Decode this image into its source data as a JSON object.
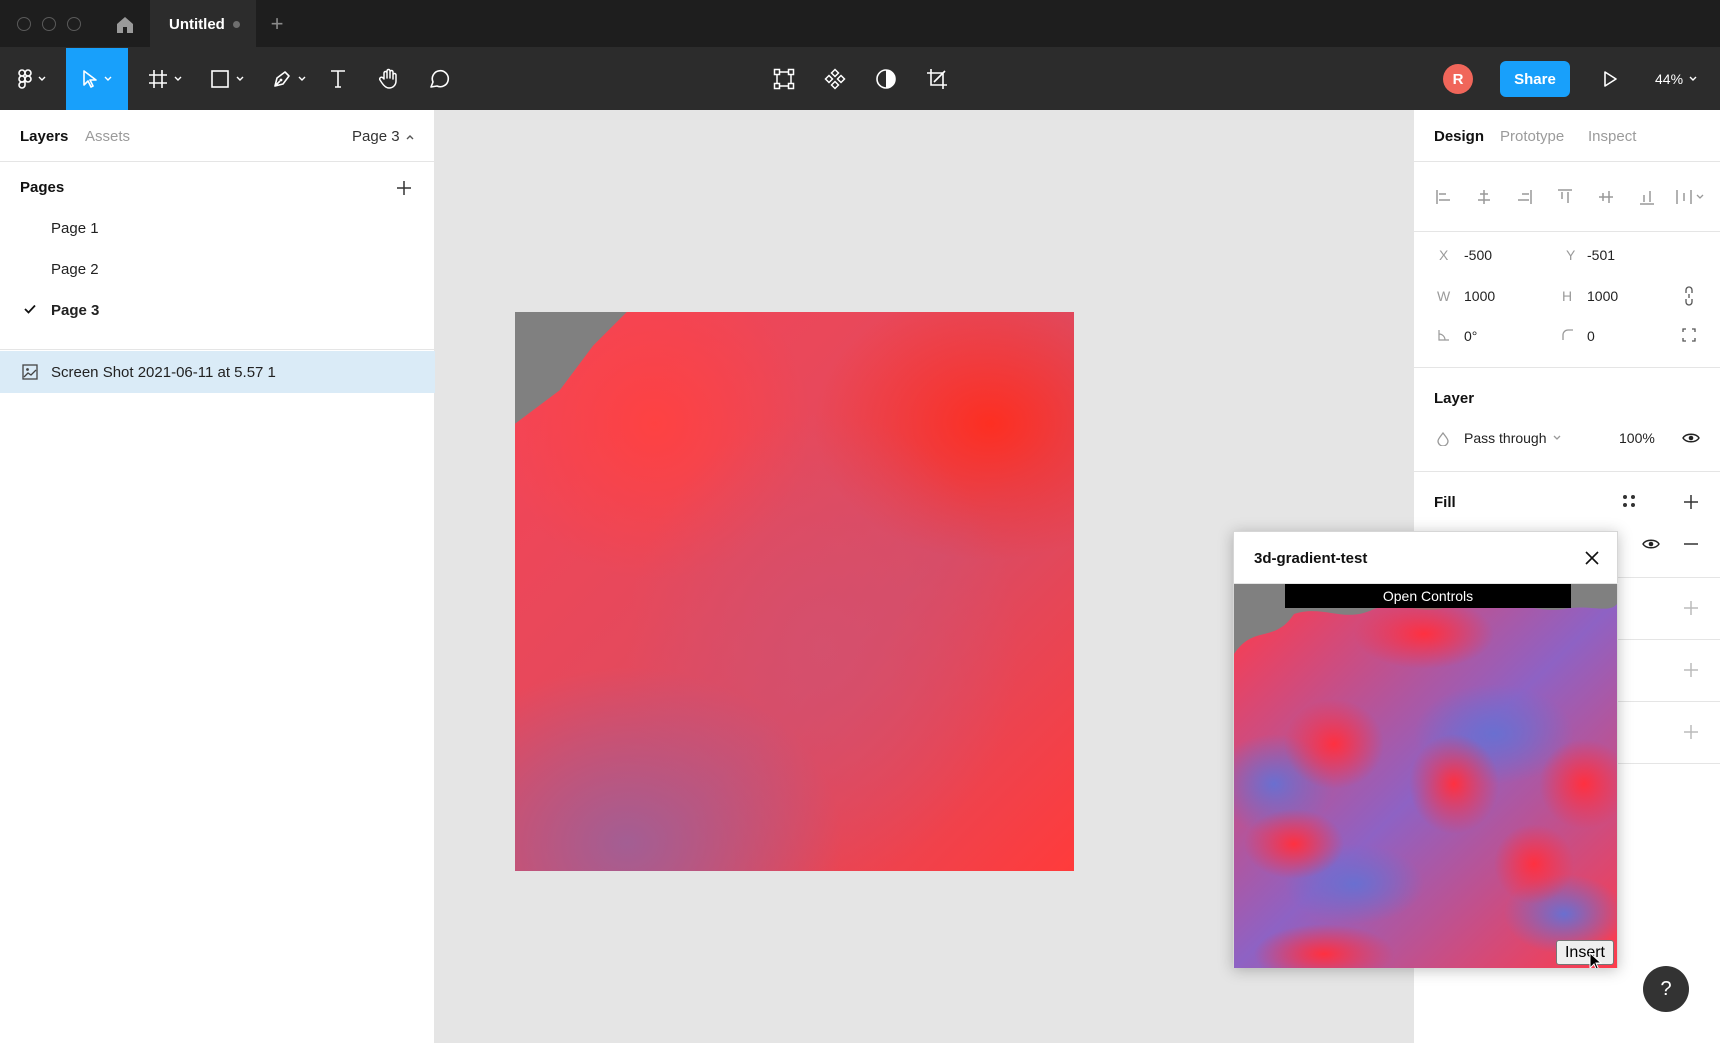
{
  "titlebar": {
    "tab_title": "Untitled",
    "add_tab": "+"
  },
  "toolbar": {
    "avatar_initial": "R",
    "share_label": "Share",
    "zoom_label": "44%"
  },
  "left_panel": {
    "tabs": [
      "Layers",
      "Assets"
    ],
    "current_page": "Page 3",
    "pages_title": "Pages",
    "pages": [
      {
        "label": "Page 1",
        "active": false
      },
      {
        "label": "Page 2",
        "active": false
      },
      {
        "label": "Page 3",
        "active": true
      }
    ],
    "layers": [
      {
        "name": "Screen Shot 2021-06-11 at 5.57 1",
        "selected": true
      }
    ]
  },
  "right_panel": {
    "tabs": [
      "Design",
      "Prototype",
      "Inspect"
    ],
    "active_tab": "Design",
    "x": {
      "label": "X",
      "value": "-500"
    },
    "y": {
      "label": "Y",
      "value": "-501"
    },
    "w": {
      "label": "W",
      "value": "1000"
    },
    "h": {
      "label": "H",
      "value": "1000"
    },
    "rotation": "0°",
    "corner_radius": "0",
    "layer_title": "Layer",
    "blend_mode": "Pass through",
    "opacity": "100%",
    "fill_title": "Fill",
    "fill_color": "#f5413f"
  },
  "plugin": {
    "title": "3d-gradient-test",
    "open_controls_label": "Open Controls",
    "insert_label": "Insert"
  },
  "help_label": "?",
  "colors": {
    "accent": "#18a0fb",
    "avatar": "#f0665a",
    "selection": "#daebf7"
  }
}
